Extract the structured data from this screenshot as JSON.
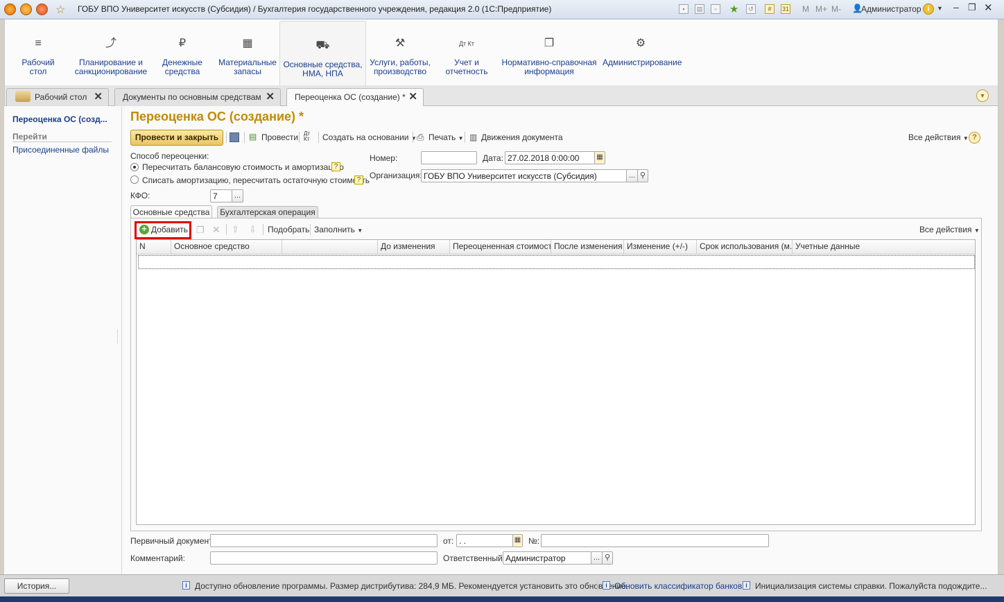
{
  "titlebar": {
    "title": "ГОБУ ВПО Университет искусств (Субсидия) / Бухгалтерия государственного учреждения, редакция 2.0  (1С:Предприятие)",
    "m_labels": [
      "M",
      "M+",
      "M-"
    ],
    "user": "Администратор"
  },
  "sections": [
    {
      "icon": "≡",
      "label": "Рабочий\nстол"
    },
    {
      "icon": "⤴",
      "label": "Планирование и\nсанкционирование"
    },
    {
      "icon": "₽",
      "label": "Денежные\nсредства"
    },
    {
      "icon": "▦",
      "label": "Материальные\nзапасы"
    },
    {
      "icon": "⛟",
      "label": "Основные средства,\nНМА, НПА"
    },
    {
      "icon": "⚒",
      "label": "Услуги, работы,\nпроизводство"
    },
    {
      "icon": "Дт Кт",
      "label": "Учет и\nотчетность"
    },
    {
      "icon": "❐",
      "label": "Нормативно-справочная\nинформация"
    },
    {
      "icon": "⚙",
      "label": "Администрирование"
    }
  ],
  "window_tabs": [
    {
      "label": "Рабочий стол"
    },
    {
      "label": "Документы по основным средствам"
    },
    {
      "label": "Переоценка ОС (создание) *"
    }
  ],
  "left_panel": {
    "title": "Переоценка ОС (созд...",
    "goto_label": "Перейти",
    "attached_files": "Присоединенные файлы"
  },
  "form": {
    "title": "Переоценка ОС (создание) *",
    "toolbar": {
      "post_close": "Провести и закрыть",
      "post": "Провести",
      "dt_kt": "Дт Кт",
      "create_based": "Создать на основании",
      "print": "Печать",
      "movements": "Движения документа",
      "all_actions": "Все действия"
    },
    "method_label": "Способ переоценки:",
    "radio1": "Пересчитать балансовую стоимость и амортизацию",
    "radio2": "Списать амортизацию, пересчитать остаточную стоимость",
    "kfo_label": "КФО:",
    "kfo_value": "7",
    "number_label": "Номер:",
    "number_value": "",
    "date_label": "Дата:",
    "date_value": "27.02.2018  0:00:00",
    "org_label": "Организация:",
    "org_value": "ГОБУ ВПО Университет искусств (Субсидия)",
    "tabs": [
      "Основные средства",
      "Бухгалтерская операция"
    ],
    "table_toolbar": {
      "add": "Добавить",
      "select": "Подобрать",
      "fill": "Заполнить",
      "all_actions": "Все действия"
    },
    "columns": [
      "N",
      "Основное средство",
      "",
      "До изменения",
      "Переоцененная стоимость",
      "После изменения",
      "Изменение (+/-)",
      "Срок использования (м...",
      "Учетные данные"
    ],
    "primary_doc_label": "Первичный документ:",
    "primary_doc_value": "",
    "from_label": "от:",
    "from_value": " .  .",
    "no_label": "№:",
    "no_value": "",
    "comment_label": "Комментарий:",
    "comment_value": "",
    "responsible_label": "Ответственный:",
    "responsible_value": "Администратор"
  },
  "statusbar": {
    "history": "История...",
    "msg1": "Доступно обновление программы. Размер дистрибутива: 284,9 МБ. Рекомендуется установить это обновление.",
    "msg2": "Обновить классификатор банков",
    "msg3": "Инициализация системы справки. Пожалуйста подождите..."
  },
  "colors": {
    "accent": "#c38a00",
    "link": "#1a3e8c",
    "highlight_box": "#e00000"
  }
}
